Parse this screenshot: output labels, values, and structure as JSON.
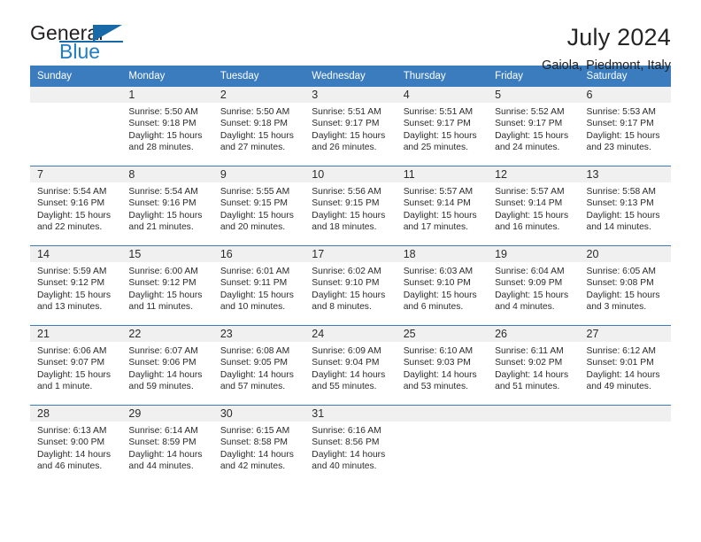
{
  "brand": {
    "name_part1": "General",
    "name_part2": "Blue",
    "flag_icon": "triangle-flag-icon"
  },
  "header": {
    "title": "July 2024",
    "subtitle": "Gaiola, Piedmont, Italy"
  },
  "colors": {
    "header_blue": "#3a7cbe",
    "brand_blue": "#1f7dc4",
    "daynum_band": "#f0f0f0",
    "text": "#2b2b2b"
  },
  "calendar": {
    "weekday_headers": [
      "Sunday",
      "Monday",
      "Tuesday",
      "Wednesday",
      "Thursday",
      "Friday",
      "Saturday"
    ],
    "weeks": [
      [
        {
          "day": "",
          "sunrise": "",
          "sunset": "",
          "daylight": "",
          "empty": true
        },
        {
          "day": "1",
          "sunrise": "Sunrise: 5:50 AM",
          "sunset": "Sunset: 9:18 PM",
          "daylight": "Daylight: 15 hours and 28 minutes."
        },
        {
          "day": "2",
          "sunrise": "Sunrise: 5:50 AM",
          "sunset": "Sunset: 9:18 PM",
          "daylight": "Daylight: 15 hours and 27 minutes."
        },
        {
          "day": "3",
          "sunrise": "Sunrise: 5:51 AM",
          "sunset": "Sunset: 9:17 PM",
          "daylight": "Daylight: 15 hours and 26 minutes."
        },
        {
          "day": "4",
          "sunrise": "Sunrise: 5:51 AM",
          "sunset": "Sunset: 9:17 PM",
          "daylight": "Daylight: 15 hours and 25 minutes."
        },
        {
          "day": "5",
          "sunrise": "Sunrise: 5:52 AM",
          "sunset": "Sunset: 9:17 PM",
          "daylight": "Daylight: 15 hours and 24 minutes."
        },
        {
          "day": "6",
          "sunrise": "Sunrise: 5:53 AM",
          "sunset": "Sunset: 9:17 PM",
          "daylight": "Daylight: 15 hours and 23 minutes."
        }
      ],
      [
        {
          "day": "7",
          "sunrise": "Sunrise: 5:54 AM",
          "sunset": "Sunset: 9:16 PM",
          "daylight": "Daylight: 15 hours and 22 minutes."
        },
        {
          "day": "8",
          "sunrise": "Sunrise: 5:54 AM",
          "sunset": "Sunset: 9:16 PM",
          "daylight": "Daylight: 15 hours and 21 minutes."
        },
        {
          "day": "9",
          "sunrise": "Sunrise: 5:55 AM",
          "sunset": "Sunset: 9:15 PM",
          "daylight": "Daylight: 15 hours and 20 minutes."
        },
        {
          "day": "10",
          "sunrise": "Sunrise: 5:56 AM",
          "sunset": "Sunset: 9:15 PM",
          "daylight": "Daylight: 15 hours and 18 minutes."
        },
        {
          "day": "11",
          "sunrise": "Sunrise: 5:57 AM",
          "sunset": "Sunset: 9:14 PM",
          "daylight": "Daylight: 15 hours and 17 minutes."
        },
        {
          "day": "12",
          "sunrise": "Sunrise: 5:57 AM",
          "sunset": "Sunset: 9:14 PM",
          "daylight": "Daylight: 15 hours and 16 minutes."
        },
        {
          "day": "13",
          "sunrise": "Sunrise: 5:58 AM",
          "sunset": "Sunset: 9:13 PM",
          "daylight": "Daylight: 15 hours and 14 minutes."
        }
      ],
      [
        {
          "day": "14",
          "sunrise": "Sunrise: 5:59 AM",
          "sunset": "Sunset: 9:12 PM",
          "daylight": "Daylight: 15 hours and 13 minutes."
        },
        {
          "day": "15",
          "sunrise": "Sunrise: 6:00 AM",
          "sunset": "Sunset: 9:12 PM",
          "daylight": "Daylight: 15 hours and 11 minutes."
        },
        {
          "day": "16",
          "sunrise": "Sunrise: 6:01 AM",
          "sunset": "Sunset: 9:11 PM",
          "daylight": "Daylight: 15 hours and 10 minutes."
        },
        {
          "day": "17",
          "sunrise": "Sunrise: 6:02 AM",
          "sunset": "Sunset: 9:10 PM",
          "daylight": "Daylight: 15 hours and 8 minutes."
        },
        {
          "day": "18",
          "sunrise": "Sunrise: 6:03 AM",
          "sunset": "Sunset: 9:10 PM",
          "daylight": "Daylight: 15 hours and 6 minutes."
        },
        {
          "day": "19",
          "sunrise": "Sunrise: 6:04 AM",
          "sunset": "Sunset: 9:09 PM",
          "daylight": "Daylight: 15 hours and 4 minutes."
        },
        {
          "day": "20",
          "sunrise": "Sunrise: 6:05 AM",
          "sunset": "Sunset: 9:08 PM",
          "daylight": "Daylight: 15 hours and 3 minutes."
        }
      ],
      [
        {
          "day": "21",
          "sunrise": "Sunrise: 6:06 AM",
          "sunset": "Sunset: 9:07 PM",
          "daylight": "Daylight: 15 hours and 1 minute."
        },
        {
          "day": "22",
          "sunrise": "Sunrise: 6:07 AM",
          "sunset": "Sunset: 9:06 PM",
          "daylight": "Daylight: 14 hours and 59 minutes."
        },
        {
          "day": "23",
          "sunrise": "Sunrise: 6:08 AM",
          "sunset": "Sunset: 9:05 PM",
          "daylight": "Daylight: 14 hours and 57 minutes."
        },
        {
          "day": "24",
          "sunrise": "Sunrise: 6:09 AM",
          "sunset": "Sunset: 9:04 PM",
          "daylight": "Daylight: 14 hours and 55 minutes."
        },
        {
          "day": "25",
          "sunrise": "Sunrise: 6:10 AM",
          "sunset": "Sunset: 9:03 PM",
          "daylight": "Daylight: 14 hours and 53 minutes."
        },
        {
          "day": "26",
          "sunrise": "Sunrise: 6:11 AM",
          "sunset": "Sunset: 9:02 PM",
          "daylight": "Daylight: 14 hours and 51 minutes."
        },
        {
          "day": "27",
          "sunrise": "Sunrise: 6:12 AM",
          "sunset": "Sunset: 9:01 PM",
          "daylight": "Daylight: 14 hours and 49 minutes."
        }
      ],
      [
        {
          "day": "28",
          "sunrise": "Sunrise: 6:13 AM",
          "sunset": "Sunset: 9:00 PM",
          "daylight": "Daylight: 14 hours and 46 minutes."
        },
        {
          "day": "29",
          "sunrise": "Sunrise: 6:14 AM",
          "sunset": "Sunset: 8:59 PM",
          "daylight": "Daylight: 14 hours and 44 minutes."
        },
        {
          "day": "30",
          "sunrise": "Sunrise: 6:15 AM",
          "sunset": "Sunset: 8:58 PM",
          "daylight": "Daylight: 14 hours and 42 minutes."
        },
        {
          "day": "31",
          "sunrise": "Sunrise: 6:16 AM",
          "sunset": "Sunset: 8:56 PM",
          "daylight": "Daylight: 14 hours and 40 minutes."
        },
        {
          "day": "",
          "sunrise": "",
          "sunset": "",
          "daylight": "",
          "empty": true
        },
        {
          "day": "",
          "sunrise": "",
          "sunset": "",
          "daylight": "",
          "empty": true
        },
        {
          "day": "",
          "sunrise": "",
          "sunset": "",
          "daylight": "",
          "empty": true
        }
      ]
    ]
  }
}
